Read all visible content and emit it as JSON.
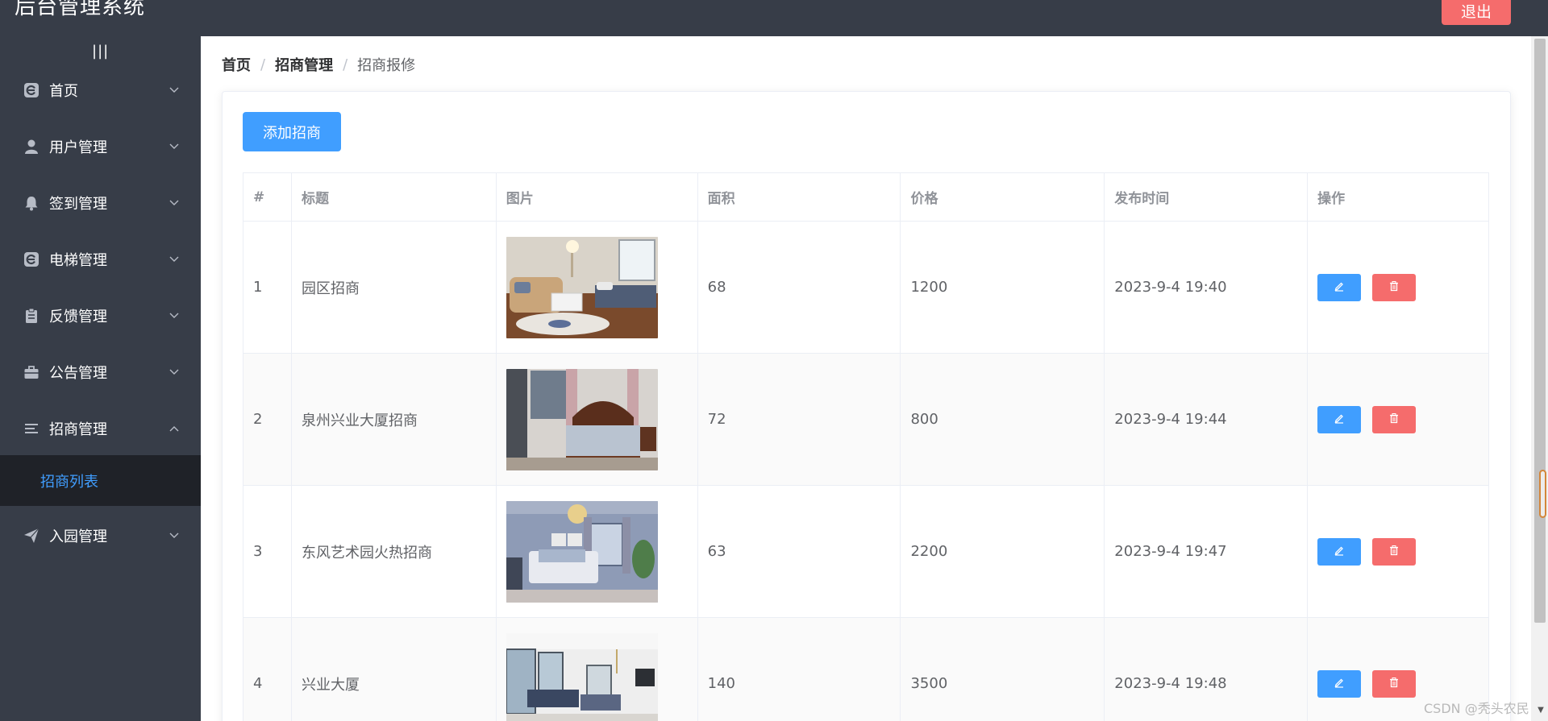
{
  "header": {
    "title": "后台管理系统",
    "logout_label": "退出"
  },
  "sidebar": {
    "toggle_glyph": "|||",
    "items": [
      {
        "label": "首页",
        "icon": "e-logo-icon",
        "arrow": "down"
      },
      {
        "label": "用户管理",
        "icon": "user-icon",
        "arrow": "down"
      },
      {
        "label": "签到管理",
        "icon": "bell-icon",
        "arrow": "down"
      },
      {
        "label": "电梯管理",
        "icon": "e-logo-icon",
        "arrow": "down"
      },
      {
        "label": "反馈管理",
        "icon": "clipboard-icon",
        "arrow": "down"
      },
      {
        "label": "公告管理",
        "icon": "briefcase-icon",
        "arrow": "down"
      },
      {
        "label": "招商管理",
        "icon": "list-icon",
        "arrow": "up"
      },
      {
        "label": "入园管理",
        "icon": "paper-plane-icon",
        "arrow": "down"
      }
    ],
    "active_submenu": {
      "label": "招商列表"
    }
  },
  "breadcrumb": {
    "home": "首页",
    "section": "招商管理",
    "current": "招商报修",
    "separator": "/"
  },
  "toolbar": {
    "add_label": "添加招商"
  },
  "table": {
    "columns": [
      "#",
      "标题",
      "图片",
      "面积",
      "价格",
      "发布时间",
      "操作"
    ],
    "rows": [
      {
        "index": "1",
        "title": "园区招商",
        "area": "68",
        "price": "1200",
        "time": "2023-9-4 19:40"
      },
      {
        "index": "2",
        "title": "泉州兴业大厦招商",
        "area": "72",
        "price": "800",
        "time": "2023-9-4 19:44"
      },
      {
        "index": "3",
        "title": "东风艺术园火热招商",
        "area": "63",
        "price": "2200",
        "time": "2023-9-4 19:47"
      },
      {
        "index": "4",
        "title": "兴业大厦",
        "area": "140",
        "price": "3500",
        "time": "2023-9-4 19:48"
      }
    ]
  },
  "colors": {
    "primary": "#409eff",
    "danger": "#f56c6c",
    "sidebar_bg": "#373d48",
    "submenu_bg": "#1f2228"
  },
  "watermark": "CSDN @秃头农民"
}
